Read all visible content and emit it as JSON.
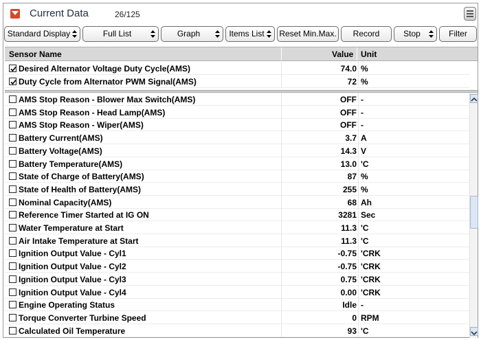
{
  "header": {
    "title": "Current Data",
    "count": "26/125"
  },
  "toolbar": {
    "standard_display": "Standard Display",
    "full_list": "Full List",
    "graph": "Graph",
    "items_list": "Items List",
    "reset_min_max": "Reset Min.Max.",
    "record": "Record",
    "stop": "Stop",
    "filter": "Filter"
  },
  "columns": {
    "name": "Sensor Name",
    "value": "Value",
    "unit": "Unit"
  },
  "pinned": [
    {
      "name": "Desired Alternator Voltage Duty Cycle(AMS)",
      "value": "74.0",
      "unit": "%",
      "checked": true
    },
    {
      "name": "Duty Cycle from Alternator PWM Signal(AMS)",
      "value": "72",
      "unit": "%",
      "checked": true
    }
  ],
  "rows": [
    {
      "name": "AMS Stop Reason - Blower Max Switch(AMS)",
      "value": "OFF",
      "unit": "-",
      "checked": false
    },
    {
      "name": "AMS Stop Reason - Head Lamp(AMS)",
      "value": "OFF",
      "unit": "-",
      "checked": false
    },
    {
      "name": "AMS Stop Reason - Wiper(AMS)",
      "value": "OFF",
      "unit": "-",
      "checked": false
    },
    {
      "name": "Battery Current(AMS)",
      "value": "3.7",
      "unit": "A",
      "checked": false
    },
    {
      "name": "Battery Voltage(AMS)",
      "value": "14.3",
      "unit": "V",
      "checked": false
    },
    {
      "name": "Battery Temperature(AMS)",
      "value": "13.0",
      "unit": "'C",
      "checked": false
    },
    {
      "name": "State of Charge of Battery(AMS)",
      "value": "87",
      "unit": "%",
      "checked": false
    },
    {
      "name": "State of Health of Battery(AMS)",
      "value": "255",
      "unit": "%",
      "checked": false
    },
    {
      "name": "Nominal Capacity(AMS)",
      "value": "68",
      "unit": "Ah",
      "checked": false
    },
    {
      "name": "Reference Timer Started at IG ON",
      "value": "3281",
      "unit": "Sec",
      "checked": false
    },
    {
      "name": "Water Temperature at Start",
      "value": "11.3",
      "unit": "'C",
      "checked": false
    },
    {
      "name": "Air Intake Temperature at Start",
      "value": "11.3",
      "unit": "'C",
      "checked": false
    },
    {
      "name": "Ignition Output Value - Cyl1",
      "value": "-0.75",
      "unit": "'CRK",
      "checked": false
    },
    {
      "name": "Ignition Output Value - Cyl2",
      "value": "-0.75",
      "unit": "'CRK",
      "checked": false
    },
    {
      "name": "Ignition Output Value - Cyl3",
      "value": "0.75",
      "unit": "'CRK",
      "checked": false
    },
    {
      "name": "Ignition Output Value - Cyl4",
      "value": "0.00",
      "unit": "'CRK",
      "checked": false
    },
    {
      "name": "Engine Operating Status",
      "value": "Idle",
      "unit": "-",
      "checked": false
    },
    {
      "name": "Torque Converter Turbine Speed",
      "value": "0",
      "unit": "RPM",
      "checked": false
    },
    {
      "name": "Calculated Oil Temperature",
      "value": "93",
      "unit": "'C",
      "checked": false
    }
  ],
  "colors": {
    "accent": "#d9472b",
    "header_bg": "#d8d8d8",
    "scroll": "#dce6f4"
  }
}
